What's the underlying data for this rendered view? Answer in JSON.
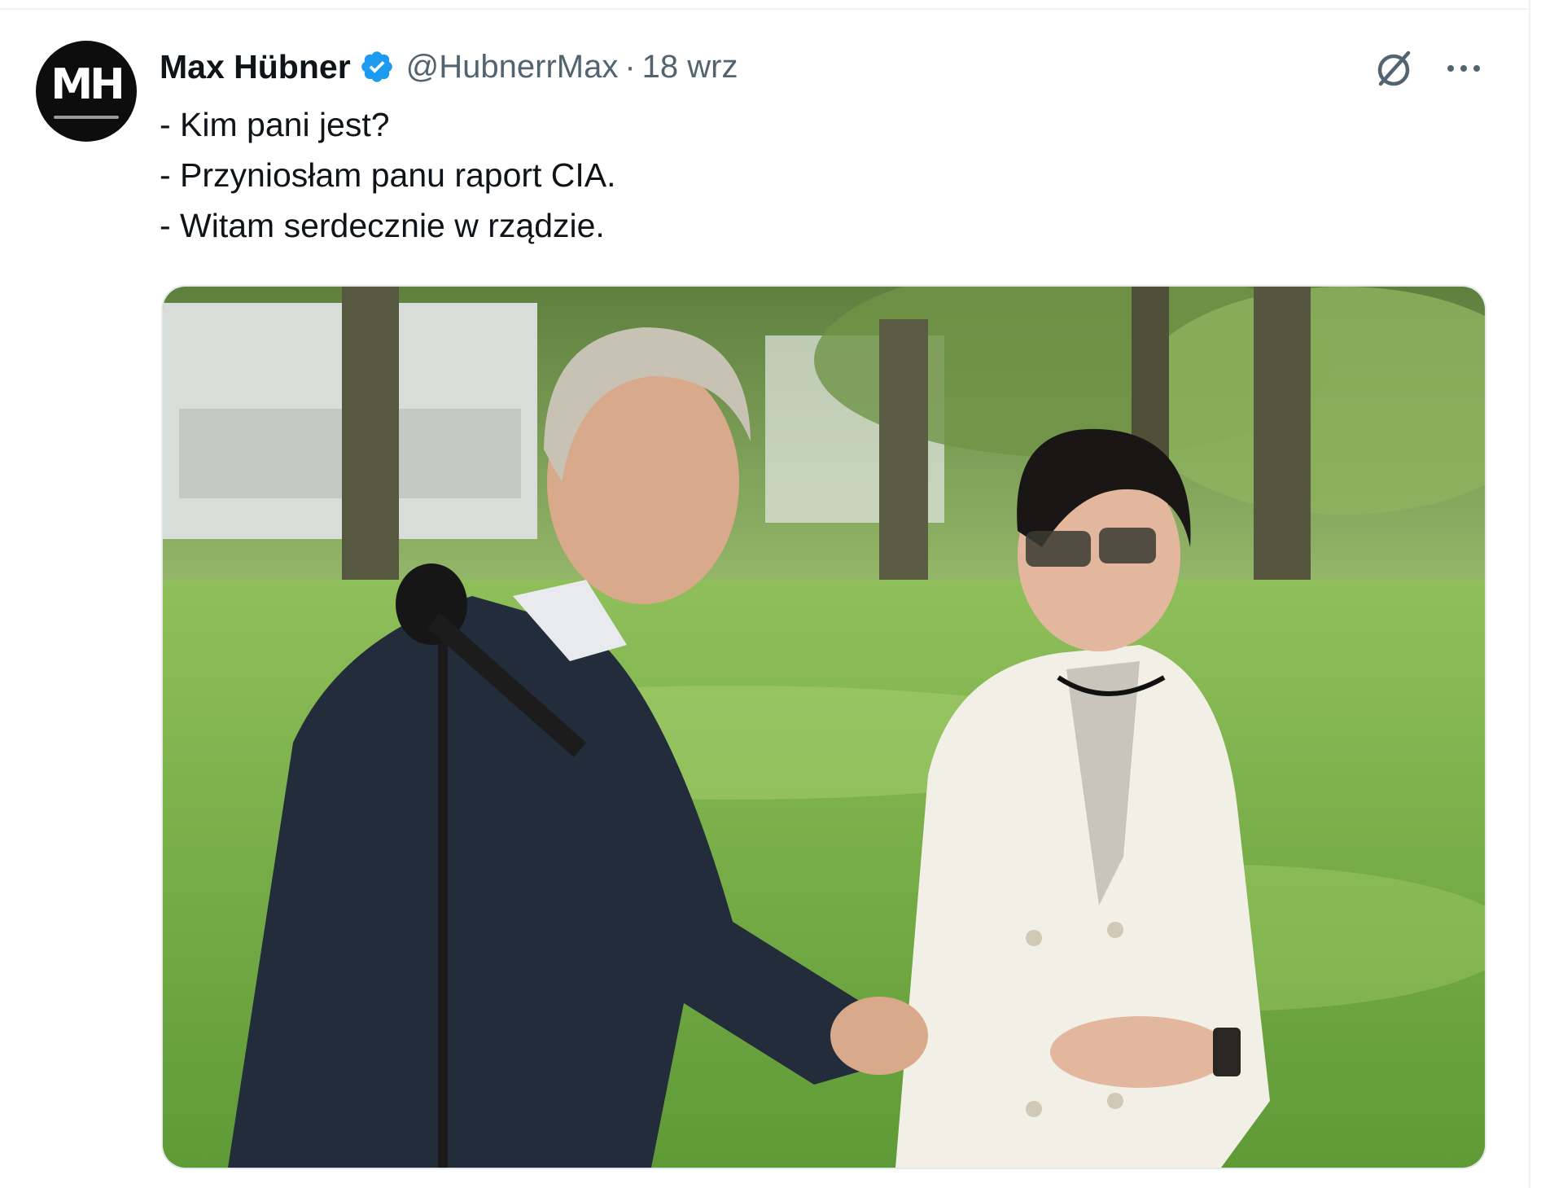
{
  "tweet": {
    "author": {
      "name": "Max Hübner",
      "handle": "@HubnerrMax",
      "avatar_text": "MH",
      "verified": true
    },
    "separator": "·",
    "timestamp": "18 wrz",
    "lines": [
      "- Kim pani jest?",
      "- Przyniosłam panu raport CIA.",
      "- Witam serdecznie w rządzie."
    ],
    "media": {
      "icon": "photo"
    }
  },
  "actions": {
    "grok_icon": "grok-icon",
    "more_icon": "more-icon"
  },
  "colors": {
    "text": "#0f1419",
    "secondary": "#536471",
    "verified": "#1d9bf0",
    "divider": "#eff3f4"
  }
}
